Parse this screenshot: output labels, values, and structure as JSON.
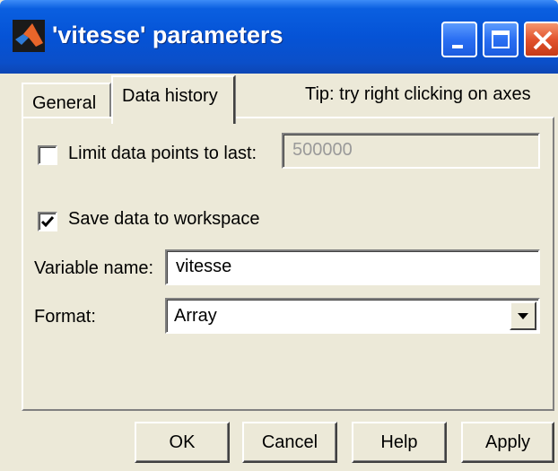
{
  "window": {
    "title": "'vitesse' parameters"
  },
  "tabs": {
    "general_label": "General",
    "data_history_label": "Data history"
  },
  "tip": "Tip:  try right clicking on axes",
  "data_history": {
    "limit_points": {
      "label": "Limit data points to last:",
      "checked": false,
      "value": "500000"
    },
    "save_to_workspace": {
      "label": "Save data to workspace",
      "checked": true
    },
    "variable_name": {
      "label": "Variable name:",
      "value": "vitesse"
    },
    "format": {
      "label": "Format:",
      "selected": "Array"
    }
  },
  "buttons": {
    "ok": "OK",
    "cancel": "Cancel",
    "help": "Help",
    "apply": "Apply"
  },
  "colors": {
    "titlebar": "#0553d6",
    "dialog_bg": "#ece9d8",
    "close_button": "#e2532e"
  },
  "icons": [
    "matlab-logo-icon",
    "minimize-icon",
    "maximize-icon",
    "close-icon",
    "check-icon",
    "dropdown-arrow-icon"
  ]
}
